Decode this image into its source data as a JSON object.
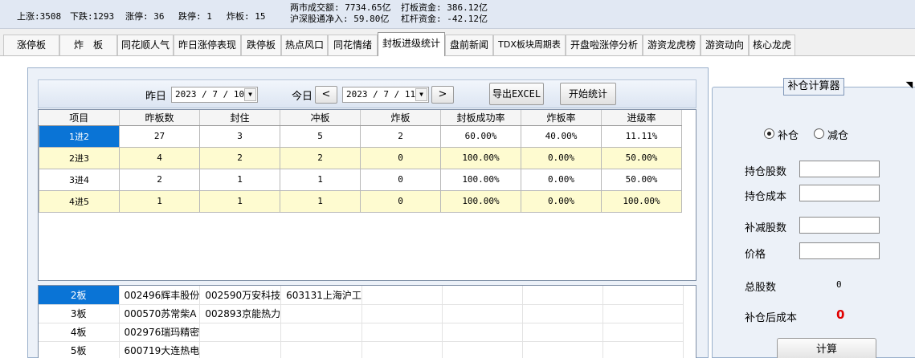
{
  "status": {
    "up": "上涨:3508",
    "down": "下跌:1293",
    "limit_up": "涨停: 36",
    "limit_down": "跌停: 1",
    "broken": "炸板: 15",
    "turnover": "两市成交额: 7734.65亿",
    "north_flow": "沪深股通净入: 59.80亿",
    "hit_board_funds": "打板资金: 386.12亿",
    "leverage_funds": "杠杆资金: -42.12亿"
  },
  "tabs": [
    "涨停板",
    "炸　板",
    "同花顺人气",
    "昨日涨停表现",
    "跌停板",
    "热点风口",
    "同花情绪",
    "封板进级统计",
    "盘前新闻",
    "TDX板块周期表",
    "开盘啦涨停分析",
    "游资龙虎榜",
    "游资动向",
    "核心龙虎"
  ],
  "toolbar": {
    "yesterday_label": "昨日",
    "yesterday_date": "2023 / 7 / 10",
    "today_label": "今日",
    "today_date": "2023 / 7 / 11",
    "prev": "<",
    "next": ">",
    "export_label": "导出EXCEL",
    "start_label": "开始统计",
    "dropdown": "▼"
  },
  "stats_table": {
    "headers": [
      "项目",
      "昨板数",
      "封住",
      "冲板",
      "炸板",
      "封板成功率",
      "炸板率",
      "进级率"
    ],
    "rows": [
      [
        "1进2",
        "27",
        "3",
        "5",
        "2",
        "60.00%",
        "40.00%",
        "11.11%"
      ],
      [
        "2进3",
        "4",
        "2",
        "2",
        "0",
        "100.00%",
        "0.00%",
        "50.00%"
      ],
      [
        "3进4",
        "2",
        "1",
        "1",
        "0",
        "100.00%",
        "0.00%",
        "50.00%"
      ],
      [
        "4进5",
        "1",
        "1",
        "1",
        "0",
        "100.00%",
        "0.00%",
        "100.00%"
      ]
    ]
  },
  "board_table": {
    "rows": [
      [
        "2板",
        "002496辉丰股份",
        "002590万安科技",
        "603131上海沪工"
      ],
      [
        "3板",
        "000570苏常柴A",
        "002893京能热力",
        ""
      ],
      [
        "4板",
        "002976瑞玛精密",
        "",
        ""
      ],
      [
        "5板",
        "600719大连热电",
        "",
        ""
      ]
    ]
  },
  "calculator": {
    "title": "补仓计算器",
    "mode_add": "补仓",
    "mode_reduce": "减仓",
    "hold_shares_label": "持仓股数",
    "hold_cost_label": "持仓成本",
    "change_shares_label": "补减股数",
    "price_label": "价格",
    "total_shares_label": "总股数",
    "total_shares_value": "0",
    "after_cost_label": "补仓后成本",
    "after_cost_value": "0",
    "calc_label": "计算",
    "after_cost_color": "#e00000"
  }
}
